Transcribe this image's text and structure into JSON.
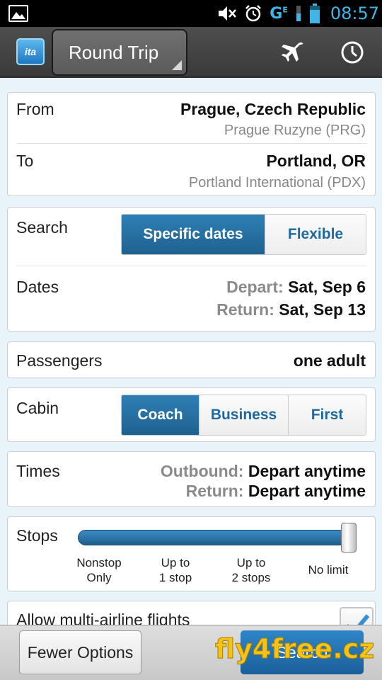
{
  "status_bar": {
    "time": "08:57",
    "network": "G",
    "network_sup": "E"
  },
  "action_bar": {
    "trip_type": "Round Trip",
    "logo_text": "ita"
  },
  "route": {
    "from_label": "From",
    "from_city": "Prague, Czech Republic",
    "from_airport": "Prague Ruzyne (PRG)",
    "to_label": "To",
    "to_city": "Portland, OR",
    "to_airport": "Portland International (PDX)"
  },
  "search": {
    "label": "Search",
    "options": [
      "Specific dates",
      "Flexible"
    ],
    "selected": "Specific dates",
    "dates_label": "Dates",
    "depart_label": "Depart:",
    "depart_value": "Sat, Sep 6",
    "return_label": "Return:",
    "return_value": "Sat, Sep 13"
  },
  "passengers": {
    "label": "Passengers",
    "value": "one adult"
  },
  "cabin": {
    "label": "Cabin",
    "options": [
      "Coach",
      "Business",
      "First"
    ],
    "selected": "Coach"
  },
  "times": {
    "label": "Times",
    "outbound_label": "Outbound:",
    "outbound_value": "Depart anytime",
    "return_label": "Return:",
    "return_value": "Depart anytime"
  },
  "stops": {
    "label": "Stops",
    "ticks": [
      [
        "Nonstop",
        "Only"
      ],
      [
        "Up to",
        "1 stop"
      ],
      [
        "Up to",
        "2 stops"
      ],
      [
        "No limit"
      ]
    ],
    "selected_index": 3
  },
  "multi_airline": {
    "label": "Allow multi-airline flights",
    "checked": true
  },
  "bottom": {
    "fewer_options": "Fewer Options",
    "search": "Search"
  },
  "watermark": "fly4free.cz",
  "colors": {
    "accent": "#1e618f",
    "status_blue": "#3fb6e6",
    "watermark": "#f5c216"
  }
}
